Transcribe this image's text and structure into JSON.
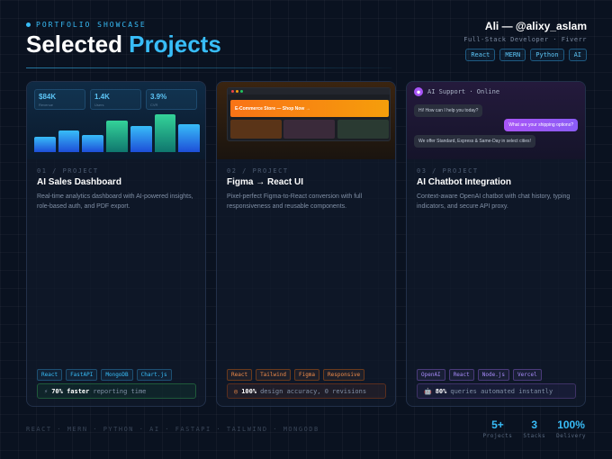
{
  "header": {
    "eyebrow": "PORTFOLIO SHOWCASE",
    "title_main": "Selected ",
    "title_accent": "Projects",
    "name": "Ali — @alixy_aslam",
    "subtitle": "Full-Stack Developer · Fiverr",
    "tags": [
      "React",
      "MERN",
      "Python",
      "AI"
    ]
  },
  "colors": {
    "accent": "#38bdf8",
    "orange": "#f97316",
    "purple": "#a855f7",
    "green": "#22c55e"
  },
  "cards": [
    {
      "num": "01 / PROJECT",
      "title": "AI Sales Dashboard",
      "desc": "Real-time analytics dashboard with AI-powered insights, role-based auth, and PDF export.",
      "tags": [
        "React",
        "FastAPI",
        "MongoDB",
        "Chart.js"
      ],
      "metric_icon": "⚡",
      "metric_bold": "70% faster",
      "metric_rest": "reporting time",
      "preview": {
        "stats": [
          {
            "value": "$84K",
            "label": "Revenue"
          },
          {
            "value": "1.4K",
            "label": "Users"
          },
          {
            "value": "3.9%",
            "label": "CVR"
          }
        ],
        "bars": [
          0.36,
          0.5,
          0.4,
          0.73,
          0.6,
          0.88,
          0.64
        ]
      }
    },
    {
      "num": "02 / PROJECT",
      "title": "Figma → React UI",
      "desc": "Pixel-perfect Figma-to-React conversion with full responsiveness and reusable components.",
      "tags": [
        "React",
        "Tailwind",
        "Figma",
        "Responsive"
      ],
      "metric_icon": "",
      "metric_bold": "100%",
      "metric_rest": "design accuracy, 0 revisions",
      "preview": {
        "banner": "E-Commerce Store — Shop Now →"
      }
    },
    {
      "num": "03 / PROJECT",
      "title": "AI Chatbot Integration",
      "desc": "Context-aware OpenAI chatbot with chat history, typing indicators, and secure API proxy.",
      "tags": [
        "OpenAI",
        "React",
        "Node.js",
        "Vercel"
      ],
      "metric_icon": "🤖",
      "metric_bold": "80%",
      "metric_rest": "queries automated instantly",
      "preview": {
        "chat_title": "AI Support · Online",
        "messages": [
          "Hi! How can I help you today?",
          "What are your shipping options?",
          "We offer Standard, Express & Same-Day in select cities!"
        ]
      }
    }
  ],
  "footer": {
    "stack": "REACT · MERN · PYTHON · AI · FASTAPI · TAILWIND · MONGODB",
    "stats": [
      {
        "value": "5+",
        "label": "Projects"
      },
      {
        "value": "3",
        "label": "Stacks"
      },
      {
        "value": "100%",
        "label": "Delivery"
      }
    ]
  }
}
